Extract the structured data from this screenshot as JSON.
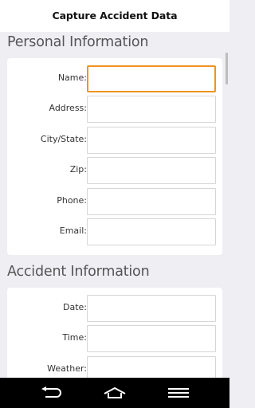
{
  "header": {
    "title": "Capture Accident Data"
  },
  "personal": {
    "title": "Personal Information",
    "fields": [
      {
        "label": "Name:",
        "value": "",
        "focused": true
      },
      {
        "label": "Address:",
        "value": ""
      },
      {
        "label": "City/State:",
        "value": ""
      },
      {
        "label": "Zip:",
        "value": ""
      },
      {
        "label": "Phone:",
        "value": ""
      },
      {
        "label": "Email:",
        "value": ""
      }
    ]
  },
  "accident": {
    "title": "Accident Information",
    "fields": [
      {
        "label": "Date:",
        "value": ""
      },
      {
        "label": "Time:",
        "value": ""
      },
      {
        "label": "Weather:",
        "value": ""
      }
    ]
  },
  "navbar": {
    "icons": [
      "back-icon",
      "home-icon",
      "menu-icon"
    ]
  },
  "colors": {
    "accent_focus": "#f0931f",
    "background": "#efeef3"
  }
}
